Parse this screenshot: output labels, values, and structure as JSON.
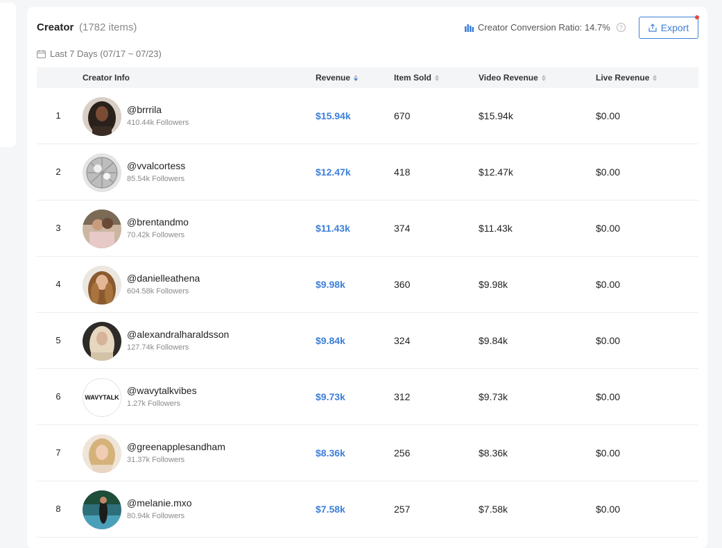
{
  "header": {
    "title": "Creator",
    "count": "(1782 items)",
    "conversion_label": "Creator Conversion Ratio: 14.7%",
    "export_label": "Export"
  },
  "date_range": "Last 7 Days (07/17 ~ 07/23)",
  "columns": {
    "creator_info": "Creator Info",
    "revenue": "Revenue",
    "item_sold": "Item Sold",
    "video_revenue": "Video Revenue",
    "live_revenue": "Live Revenue"
  },
  "rows": [
    {
      "rank": "1",
      "handle": "@brrrila",
      "followers": "410.44k Followers",
      "revenue": "$15.94k",
      "item_sold": "670",
      "video_revenue": "$15.94k",
      "live_revenue": "$0.00"
    },
    {
      "rank": "2",
      "handle": "@vvalcortess",
      "followers": "85.54k Followers",
      "revenue": "$12.47k",
      "item_sold": "418",
      "video_revenue": "$12.47k",
      "live_revenue": "$0.00"
    },
    {
      "rank": "3",
      "handle": "@brentandmo",
      "followers": "70.42k Followers",
      "revenue": "$11.43k",
      "item_sold": "374",
      "video_revenue": "$11.43k",
      "live_revenue": "$0.00"
    },
    {
      "rank": "4",
      "handle": "@danielleathena",
      "followers": "604.58k Followers",
      "revenue": "$9.98k",
      "item_sold": "360",
      "video_revenue": "$9.98k",
      "live_revenue": "$0.00"
    },
    {
      "rank": "5",
      "handle": "@alexandralharaldsson",
      "followers": "127.74k Followers",
      "revenue": "$9.84k",
      "item_sold": "324",
      "video_revenue": "$9.84k",
      "live_revenue": "$0.00"
    },
    {
      "rank": "6",
      "handle": "@wavytalkvibes",
      "followers": "1.27k Followers",
      "revenue": "$9.73k",
      "item_sold": "312",
      "video_revenue": "$9.73k",
      "live_revenue": "$0.00"
    },
    {
      "rank": "7",
      "handle": "@greenapplesandham",
      "followers": "31.37k Followers",
      "revenue": "$8.36k",
      "item_sold": "256",
      "video_revenue": "$8.36k",
      "live_revenue": "$0.00"
    },
    {
      "rank": "8",
      "handle": "@melanie.mxo",
      "followers": "80.94k Followers",
      "revenue": "$7.58k",
      "item_sold": "257",
      "video_revenue": "$7.58k",
      "live_revenue": "$0.00"
    }
  ],
  "avatars": {
    "wavytalk_logo_text": "WAVYTALK"
  },
  "colors": {
    "accent": "#3d7fd8",
    "export_dot": "#e84a3c"
  }
}
